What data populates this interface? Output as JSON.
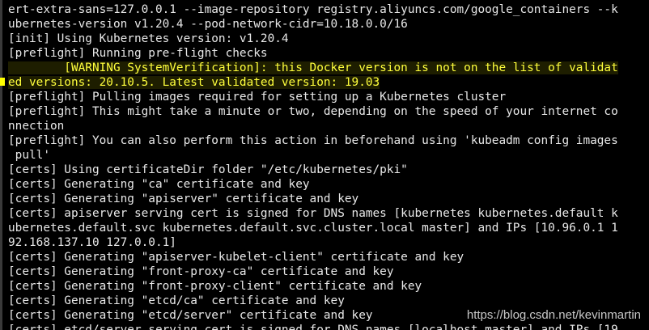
{
  "terminal": {
    "lines": [
      "ert-extra-sans=127.0.0.1 --image-repository registry.aliyuncs.com/google_containers --k",
      "ubernetes-version v1.20.4 --pod-network-cidr=10.18.0.0/16",
      "[init] Using Kubernetes version: v1.20.4",
      "[preflight] Running pre-flight checks",
      "        [WARNING SystemVerification]: this Docker version is not on the list of validat",
      "ed versions: 20.10.5. Latest validated version: 19.03",
      "[preflight] Pulling images required for setting up a Kubernetes cluster",
      "[preflight] This might take a minute or two, depending on the speed of your internet co",
      "nnection",
      "[preflight] You can also perform this action in beforehand using 'kubeadm config images",
      " pull'",
      "[certs] Using certificateDir folder \"/etc/kubernetes/pki\"",
      "[certs] Generating \"ca\" certificate and key",
      "[certs] Generating \"apiserver\" certificate and key",
      "[certs] apiserver serving cert is signed for DNS names [kubernetes kubernetes.default k",
      "ubernetes.default.svc kubernetes.default.svc.cluster.local master] and IPs [10.96.0.1 1",
      "92.168.137.10 127.0.0.1]",
      "[certs] Generating \"apiserver-kubelet-client\" certificate and key",
      "[certs] Generating \"front-proxy-ca\" certificate and key",
      "[certs] Generating \"front-proxy-client\" certificate and key",
      "[certs] Generating \"etcd/ca\" certificate and key",
      "[certs] Generating \"etcd/server\" certificate and key",
      "[certs] etcd/server serving cert is signed for DNS names [localhost master] and IPs [19"
    ],
    "highlighted_lines": [
      4,
      5
    ],
    "highlight_color": "#ffff3c",
    "text_color": "#e8e8e8",
    "background_color": "#000000"
  },
  "watermark": {
    "text": "https://blog.csdn.net/kevinmartin"
  }
}
